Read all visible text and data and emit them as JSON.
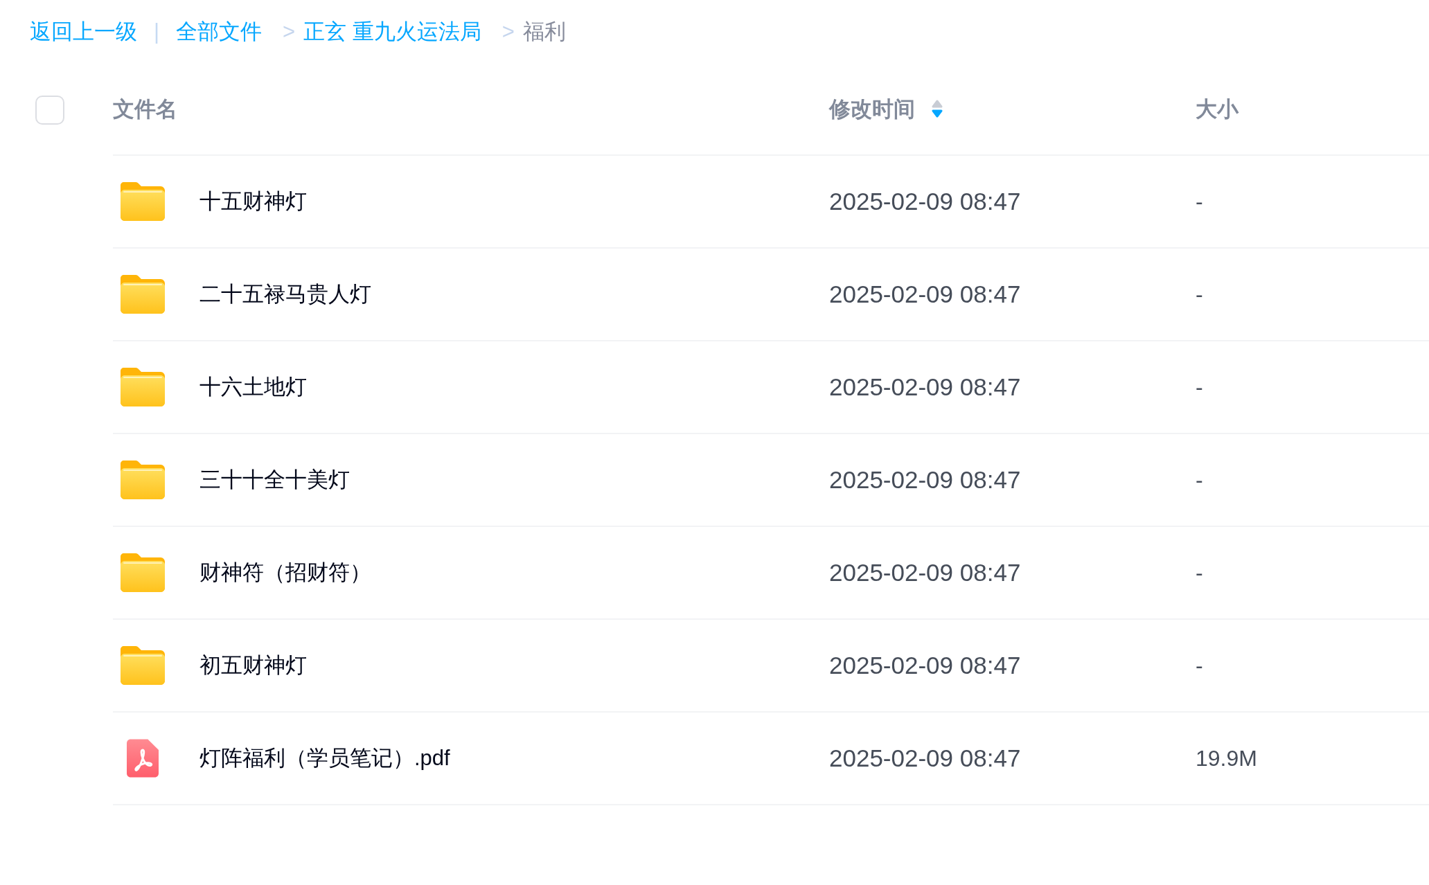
{
  "breadcrumb": [
    {
      "kind": "link",
      "text": "返回上一级"
    },
    {
      "kind": "divider",
      "text": "|"
    },
    {
      "kind": "link",
      "text": "全部文件"
    },
    {
      "kind": "separator",
      "text": ">"
    },
    {
      "kind": "link",
      "text": "正玄 重九火运法局"
    },
    {
      "kind": "separator",
      "text": ">"
    },
    {
      "kind": "current",
      "text": "福利"
    }
  ],
  "table": {
    "select_all": {
      "checked": false
    },
    "columns": [
      {
        "label": "文件名"
      },
      {
        "label": "修改时间",
        "sorted": true,
        "descending": true
      },
      {
        "label": "大小"
      }
    ],
    "rows": [
      {
        "kind": "folder",
        "name": "十五财神灯",
        "modified": "2025-02-09 08:47",
        "size": "-",
        "selected": false
      },
      {
        "kind": "folder",
        "name": "二十五禄马贵人灯",
        "modified": "2025-02-09 08:47",
        "size": "-",
        "selected": false
      },
      {
        "kind": "folder",
        "name": "十六土地灯",
        "modified": "2025-02-09 08:47",
        "size": "-",
        "selected": false
      },
      {
        "kind": "folder",
        "name": "三十十全十美灯",
        "modified": "2025-02-09 08:47",
        "size": "-",
        "selected": false
      },
      {
        "kind": "folder",
        "name": "财神符（招财符）",
        "modified": "2025-02-09 08:47",
        "size": "-",
        "selected": false
      },
      {
        "kind": "folder",
        "name": "初五财神灯",
        "modified": "2025-02-09 08:47",
        "size": "-",
        "selected": false
      },
      {
        "kind": "pdf",
        "name": "灯阵福利（学员笔记）.pdf",
        "modified": "2025-02-09 08:47",
        "size": "19.9M",
        "selected": false
      }
    ]
  }
}
